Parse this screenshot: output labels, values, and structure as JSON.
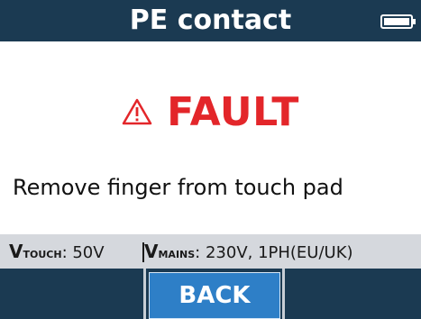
{
  "header": {
    "title": "PE contact",
    "battery_icon": "battery-icon"
  },
  "main": {
    "warning_icon": "warning-triangle-icon",
    "status": "FAULT",
    "message": "Remove finger from touch pad"
  },
  "status_bar": {
    "touch": {
      "symbol": "V",
      "subscript": "TOUCH",
      "value": ": 50V"
    },
    "mains": {
      "symbol": "V",
      "subscript": "MAINS",
      "value": ": 230V, 1PH(EU/UK)"
    }
  },
  "softkeys": {
    "left_label": "",
    "middle_label": "BACK",
    "right_label": ""
  },
  "colors": {
    "header_bg": "#1b3a52",
    "fault_red": "#e3262a",
    "button_blue": "#2e7fc7",
    "status_bar_bg": "#d5d8dd"
  }
}
